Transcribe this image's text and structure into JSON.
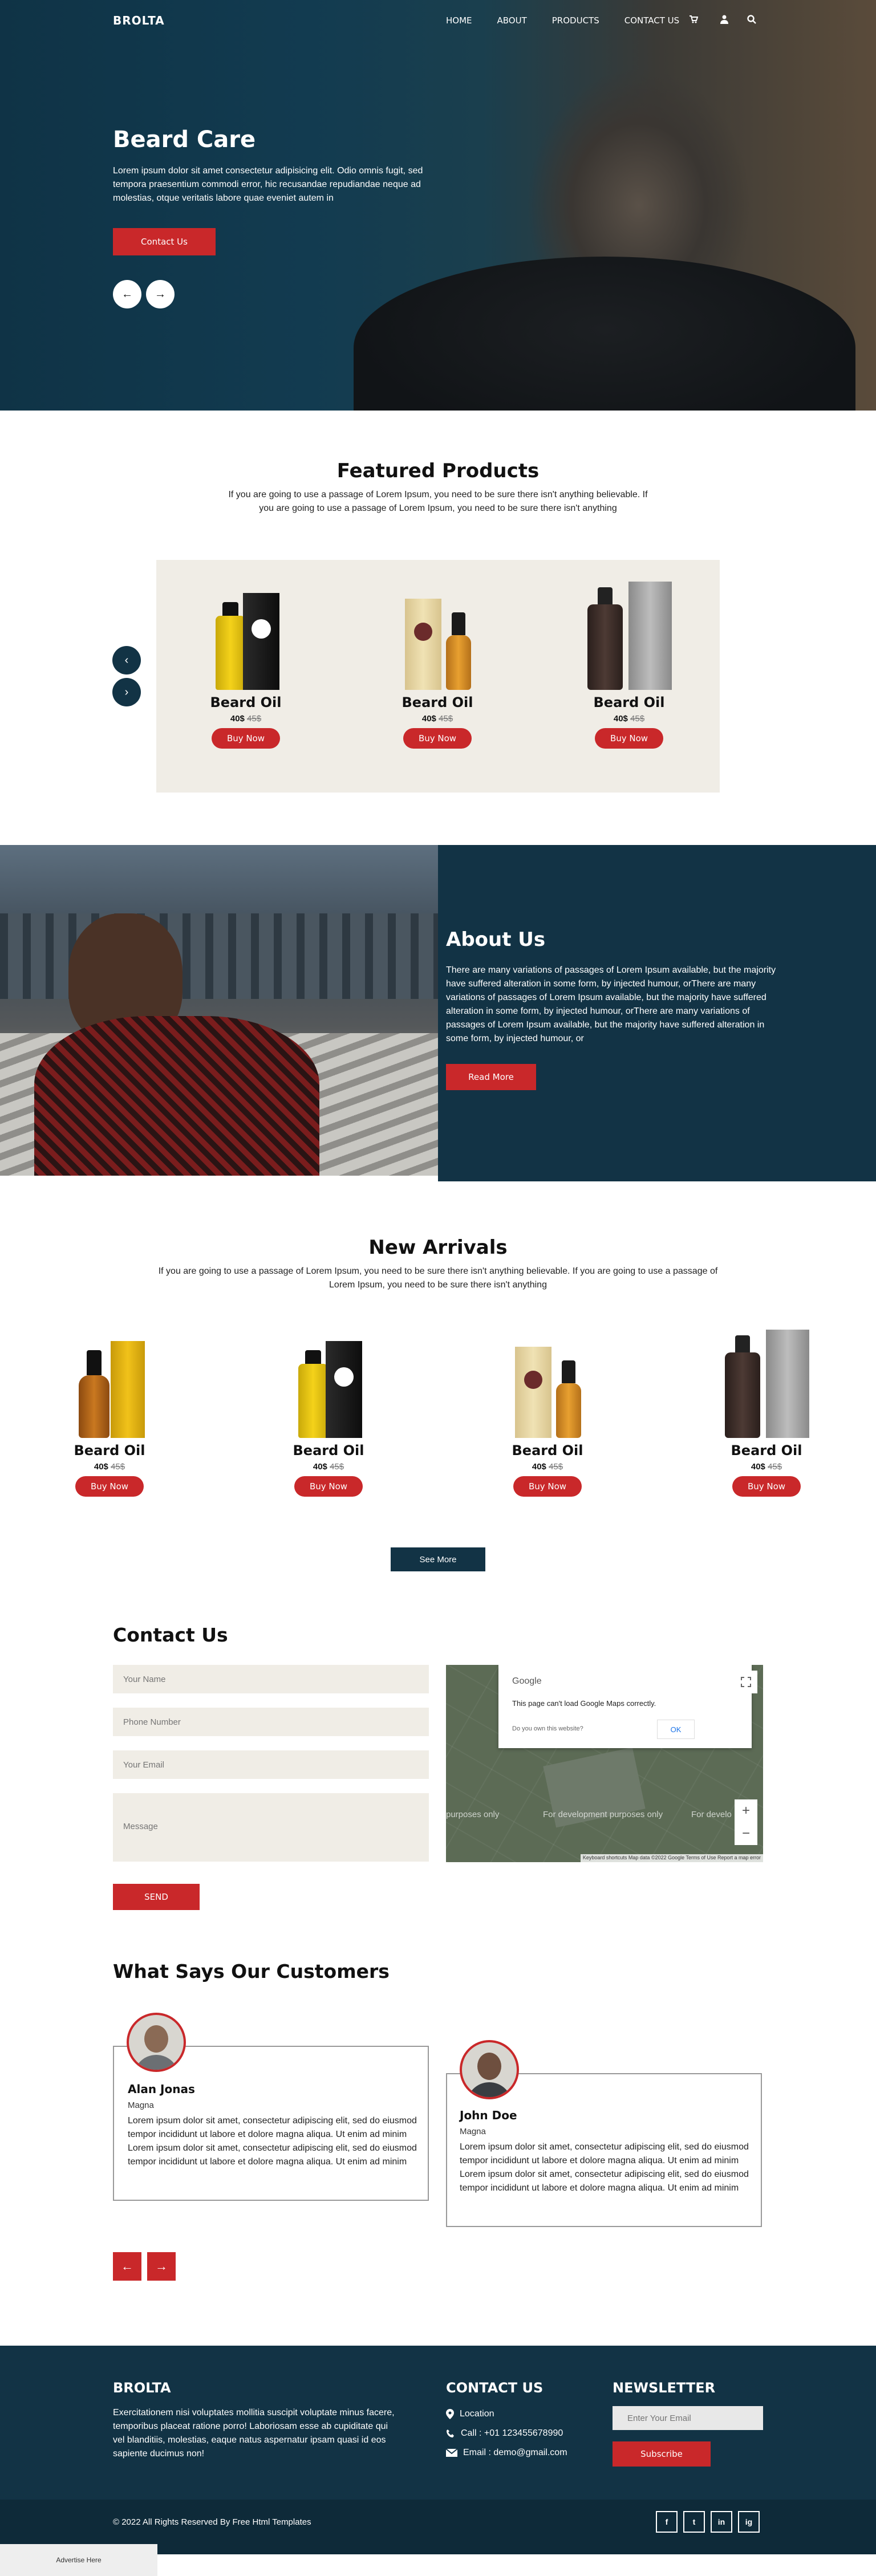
{
  "header": {
    "brand": "BROLTA",
    "nav": [
      "HOME",
      "ABOUT",
      "PRODUCTS",
      "CONTACT US"
    ],
    "icons": [
      "cart-icon",
      "user-icon",
      "search-icon"
    ]
  },
  "hero": {
    "title": "Beard Care",
    "text": "Lorem ipsum dolor sit amet consectetur adipisicing elit. Odio omnis fugit, sed tempora praesentium commodi error, hic recusandae repudiandae neque ad molestias, otque veritatis labore quae eveniet autem in",
    "button": "Contact Us",
    "prev": "←",
    "next": "→"
  },
  "featured": {
    "title": "Featured Products",
    "text": "If you are going to use a passage of Lorem Ipsum, you need to be sure there isn't anything believable. If you are going to use a passage of Lorem Ipsum, you need to be sure there isn't anything",
    "prev": "‹",
    "next": "›",
    "products": [
      {
        "name": "Beard Oil",
        "price": "40$",
        "old": "45$",
        "button": "Buy Now"
      },
      {
        "name": "Beard Oil",
        "price": "40$",
        "old": "45$",
        "button": "Buy Now"
      },
      {
        "name": "Beard Oil",
        "price": "40$",
        "old": "45$",
        "button": "Buy Now"
      }
    ]
  },
  "about": {
    "title": "About Us",
    "text": "There are many variations of passages of Lorem Ipsum available, but the majority have suffered alteration in some form, by injected humour, orThere are many variations of passages of Lorem Ipsum available, but the majority have suffered alteration in some form, by injected humour, orThere are many variations of passages of Lorem Ipsum available, but the majority have suffered alteration in some form, by injected humour, or",
    "button": "Read More"
  },
  "arrivals": {
    "title": "New Arrivals",
    "text": "If you are going to use a passage of Lorem Ipsum, you need to be sure there isn't anything believable. If you are going to use a passage of Lorem Ipsum, you need to be sure there isn't anything",
    "products": [
      {
        "name": "Beard Oil",
        "price": "40$",
        "old": "45$",
        "button": "Buy Now"
      },
      {
        "name": "Beard Oil",
        "price": "40$",
        "old": "45$",
        "button": "Buy Now"
      },
      {
        "name": "Beard Oil",
        "price": "40$",
        "old": "45$",
        "button": "Buy Now"
      },
      {
        "name": "Beard Oil",
        "price": "40$",
        "old": "45$",
        "button": "Buy Now"
      }
    ],
    "see_more": "See More"
  },
  "contact": {
    "title": "Contact Us",
    "name_ph": "Your Name",
    "phone_ph": "Phone Number",
    "email_ph": "Your Email",
    "message_ph": "Message",
    "send": "SEND",
    "map": {
      "google": "Google",
      "error": "This page can't load Google Maps correctly.",
      "question": "Do you own this website?",
      "ok": "OK",
      "label1": "purposes only",
      "label2": "For development purposes only",
      "label3": "For develo",
      "footer": "Keyboard shortcuts  Map data ©2022 Google  Terms of Use  Report a map error",
      "zoom_in": "+",
      "zoom_out": "−"
    }
  },
  "testimonials": {
    "title": "What Says Our Customers",
    "items": [
      {
        "name": "Alan Jonas",
        "role": "Magna",
        "text": "Lorem ipsum dolor sit amet, consectetur adipiscing elit, sed do eiusmod tempor incididunt ut labore et dolore magna aliqua. Ut enim ad minim Lorem ipsum dolor sit amet, consectetur adipiscing elit, sed do eiusmod tempor incididunt ut labore et dolore magna aliqua. Ut enim ad minim"
      },
      {
        "name": "John Doe",
        "role": "Magna",
        "text": "Lorem ipsum dolor sit amet, consectetur adipiscing elit, sed do eiusmod tempor incididunt ut labore et dolore magna aliqua. Ut enim ad minim Lorem ipsum dolor sit amet, consectetur adipiscing elit, sed do eiusmod tempor incididunt ut labore et dolore magna aliqua. Ut enim ad minim"
      }
    ],
    "prev": "←",
    "next": "→"
  },
  "footer": {
    "brand": "BROLTA",
    "text": "Exercitationem nisi voluptates mollitia suscipit voluptate minus facere, temporibus placeat ratione porro! Laboriosam esse ab cupiditate qui vel blanditiis, molestias, eaque natus aspernatur ipsam quasi id eos sapiente ducimus non!",
    "contact_title": "CONTACT US",
    "location": "Location",
    "call": "Call : +01 123455678990",
    "email": "Email : demo@gmail.com",
    "newsletter_title": "NEWSLETTER",
    "newsletter_ph": "Enter Your Email",
    "subscribe": "Subscribe",
    "copyright": "© 2022 All Rights Reserved By Free Html Templates",
    "social": [
      "f",
      "t",
      "in",
      "ig"
    ]
  },
  "ad": "Advertise Here",
  "colors": {
    "accent": "#c9282a",
    "navy": "#123345",
    "beige": "#f0ede6"
  }
}
